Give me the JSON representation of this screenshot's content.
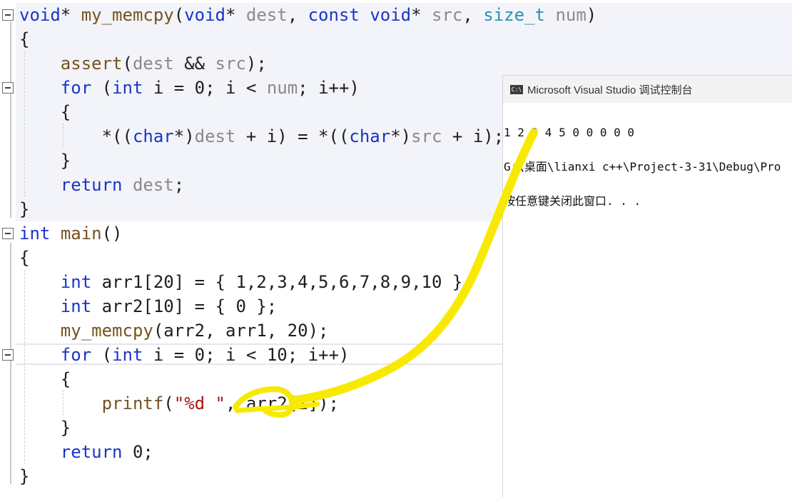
{
  "editor": {
    "lines": [
      [
        {
          "t": "void",
          "c": "kw"
        },
        {
          "t": "* "
        },
        {
          "t": "my_memcpy",
          "c": "fn"
        },
        {
          "t": "("
        },
        {
          "t": "void",
          "c": "kw"
        },
        {
          "t": "* "
        },
        {
          "t": "dest",
          "c": "par"
        },
        {
          "t": ", "
        },
        {
          "t": "const",
          "c": "kw"
        },
        {
          "t": " "
        },
        {
          "t": "void",
          "c": "kw"
        },
        {
          "t": "* "
        },
        {
          "t": "src",
          "c": "par"
        },
        {
          "t": ", "
        },
        {
          "t": "size_t",
          "c": "typ"
        },
        {
          "t": " "
        },
        {
          "t": "num",
          "c": "par"
        },
        {
          "t": ")"
        }
      ],
      [
        {
          "t": "{"
        }
      ],
      [
        {
          "t": "    "
        },
        {
          "t": "assert",
          "c": "fn"
        },
        {
          "t": "("
        },
        {
          "t": "dest",
          "c": "par"
        },
        {
          "t": " && "
        },
        {
          "t": "src",
          "c": "par"
        },
        {
          "t": ");"
        }
      ],
      [
        {
          "t": "    "
        },
        {
          "t": "for",
          "c": "kw"
        },
        {
          "t": " ("
        },
        {
          "t": "int",
          "c": "kw"
        },
        {
          "t": " i = 0; i < "
        },
        {
          "t": "num",
          "c": "par"
        },
        {
          "t": "; i++)"
        }
      ],
      [
        {
          "t": "    {"
        }
      ],
      [
        {
          "t": "        *(("
        },
        {
          "t": "char",
          "c": "kw"
        },
        {
          "t": "*)"
        },
        {
          "t": "dest",
          "c": "par"
        },
        {
          "t": " + i) = *(("
        },
        {
          "t": "char",
          "c": "kw"
        },
        {
          "t": "*)"
        },
        {
          "t": "src",
          "c": "par"
        },
        {
          "t": " + i);"
        }
      ],
      [
        {
          "t": "    }"
        }
      ],
      [
        {
          "t": "    "
        },
        {
          "t": "return",
          "c": "kw"
        },
        {
          "t": " "
        },
        {
          "t": "dest",
          "c": "par"
        },
        {
          "t": ";"
        }
      ],
      [
        {
          "t": "}"
        }
      ],
      [
        {
          "t": "int",
          "c": "kw"
        },
        {
          "t": " "
        },
        {
          "t": "main",
          "c": "fn"
        },
        {
          "t": "()"
        }
      ],
      [
        {
          "t": "{"
        }
      ],
      [
        {
          "t": "    "
        },
        {
          "t": "int",
          "c": "kw"
        },
        {
          "t": " arr1[20] = { 1,2,3,4,5,6,7,8,9,10 };"
        }
      ],
      [
        {
          "t": "    "
        },
        {
          "t": "int",
          "c": "kw"
        },
        {
          "t": " arr2[10] = { 0 };"
        }
      ],
      [
        {
          "t": "    "
        },
        {
          "t": "my_memcpy",
          "c": "fn"
        },
        {
          "t": "(arr2, arr1, 20);"
        }
      ],
      [
        {
          "t": "    "
        },
        {
          "t": "for",
          "c": "kw"
        },
        {
          "t": " ("
        },
        {
          "t": "int",
          "c": "kw"
        },
        {
          "t": " i = 0; i < 10; i++)"
        }
      ],
      [
        {
          "t": "    {"
        }
      ],
      [
        {
          "t": "        "
        },
        {
          "t": "printf",
          "c": "fn"
        },
        {
          "t": "("
        },
        {
          "t": "\"%d \"",
          "c": "str"
        },
        {
          "t": ", arr2[i]);"
        }
      ],
      [
        {
          "t": "    }"
        }
      ],
      [
        {
          "t": "    "
        },
        {
          "t": "return",
          "c": "kw"
        },
        {
          "t": " 0;"
        }
      ],
      [
        {
          "t": "}"
        }
      ]
    ]
  },
  "console": {
    "title": "Microsoft Visual Studio 调试控制台",
    "icon_text": "C:\\",
    "icon": "console-app-icon",
    "output": [
      "1 2 3 4 5 0 0 0 0 0",
      "G:\\桌面\\lianxi c++\\Project-3-31\\Debug\\Pro",
      "按任意键关闭此窗口. . ."
    ]
  },
  "colors": {
    "keyword": "#1a34c8",
    "function": "#74531f",
    "parameter": "#8a8a8a",
    "type": "#2b91af",
    "string": "#a31515",
    "highlighter": "#f7ea00"
  }
}
